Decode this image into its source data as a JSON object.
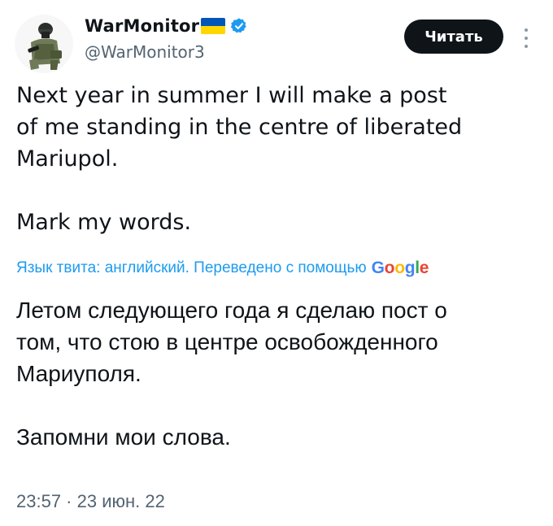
{
  "author": {
    "display_name": "WarMonitor",
    "handle": "@WarMonitor3",
    "flag_icon": "ukraine-flag-icon",
    "verified_icon": "verified-badge-icon",
    "verified_color": "#1d9bf0"
  },
  "actions": {
    "read_label": "Читать",
    "more_icon": "more-vertical-icon"
  },
  "tweet": {
    "text": "Next year in summer I will make a post\nof me standing in the centre of liberated\nMariupol.\n\nMark my words.",
    "translation_label": "Язык твита: английский. Переведено с помощью",
    "translation_provider": "Google",
    "translated_text": "Летом следующего года я сделаю пост о\nтом, что стою в центре освобожденного\nМариуполя.\n\nЗапомни мои слова.",
    "timestamp": "23:57 · 23 июн. 22"
  },
  "colors": {
    "link": "#1d9bf0",
    "secondary_text": "#536471",
    "primary_text": "#0f1419",
    "button_bg": "#0f1419"
  }
}
